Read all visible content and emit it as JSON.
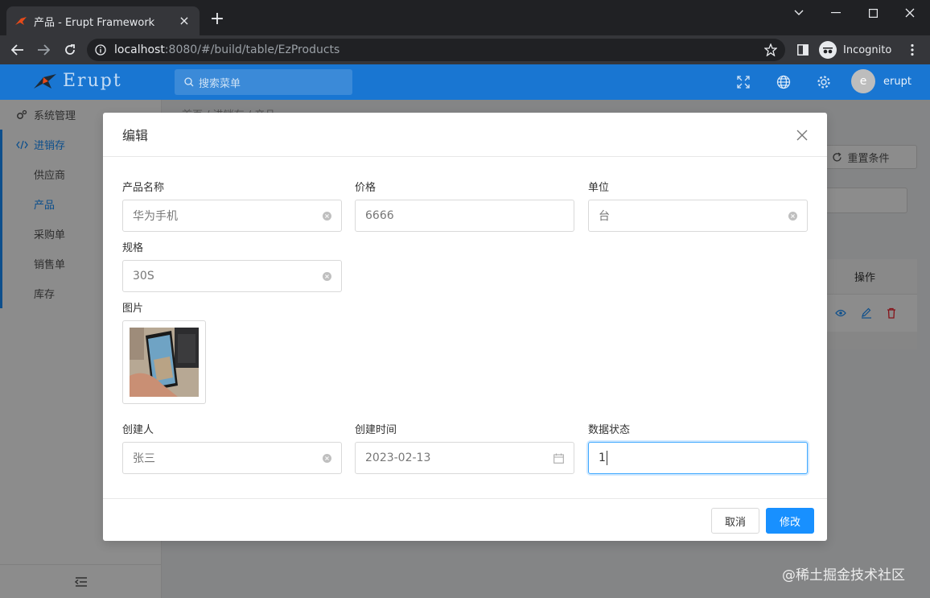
{
  "browser": {
    "tab_title": "产品 - Erupt Framework",
    "url_host": "localhost",
    "url_path": ":8080/#/build/table/EzProducts",
    "incognito_label": "Incognito"
  },
  "header": {
    "logo_text": "Erupt",
    "search_placeholder": "搜索菜单",
    "user_initial": "e",
    "user_name": "erupt",
    "accent_color": "#1976d2"
  },
  "sidebar": {
    "items": [
      {
        "label": "系统管理",
        "icon": "gears-icon"
      },
      {
        "label": "进销存",
        "icon": "code-icon"
      },
      {
        "label": "供应商"
      },
      {
        "label": "产品"
      },
      {
        "label": "采购单"
      },
      {
        "label": "销售单"
      },
      {
        "label": "库存"
      }
    ]
  },
  "background": {
    "breadcrumb": "首页  /  进销存  /  产品",
    "reset_label": "重置条件",
    "ops_header": "操作"
  },
  "modal": {
    "title": "编辑",
    "fields": {
      "name": {
        "label": "产品名称",
        "value": "华为手机"
      },
      "price": {
        "label": "价格",
        "value": "6666"
      },
      "unit": {
        "label": "单位",
        "value": "台"
      },
      "spec": {
        "label": "规格",
        "value": "30S"
      },
      "image": {
        "label": "图片"
      },
      "creator": {
        "label": "创建人",
        "value": "张三"
      },
      "created_at": {
        "label": "创建时间",
        "value": "2023-02-13"
      },
      "status": {
        "label": "数据状态",
        "value": "1"
      }
    },
    "cancel_label": "取消",
    "submit_label": "修改",
    "primary_color": "#1890ff"
  },
  "watermark": "@稀土掘金技术社区"
}
